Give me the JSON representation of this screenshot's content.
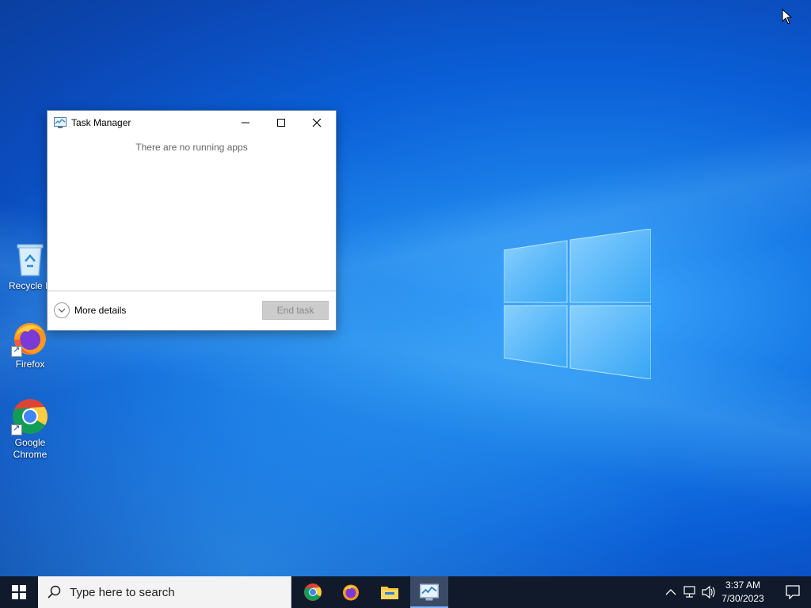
{
  "desktop": {
    "icons": [
      {
        "label": "Recycle B",
        "icon": "recycle-bin-icon"
      },
      {
        "label": "Firefox",
        "icon": "firefox-icon"
      },
      {
        "label": "Google Chrome",
        "label_line1": "Google",
        "label_line2": "Chrome",
        "icon": "chrome-icon"
      }
    ]
  },
  "task_manager": {
    "title": "Task Manager",
    "message": "There are no running apps",
    "more_details_label": "More details",
    "end_task_label": "End task"
  },
  "taskbar": {
    "search_placeholder": "Type here to search",
    "pinned_apps": [
      "chrome-icon",
      "firefox-icon",
      "file-explorer-icon",
      "task-manager-icon"
    ],
    "active_app": "task-manager-icon",
    "clock": {
      "time": "3:37 AM",
      "date": "7/30/2023"
    }
  },
  "colors": {
    "taskbar_bg": "#101a2b",
    "accent": "#7fb4ff",
    "desktop_blue": "#0a5ed6"
  }
}
